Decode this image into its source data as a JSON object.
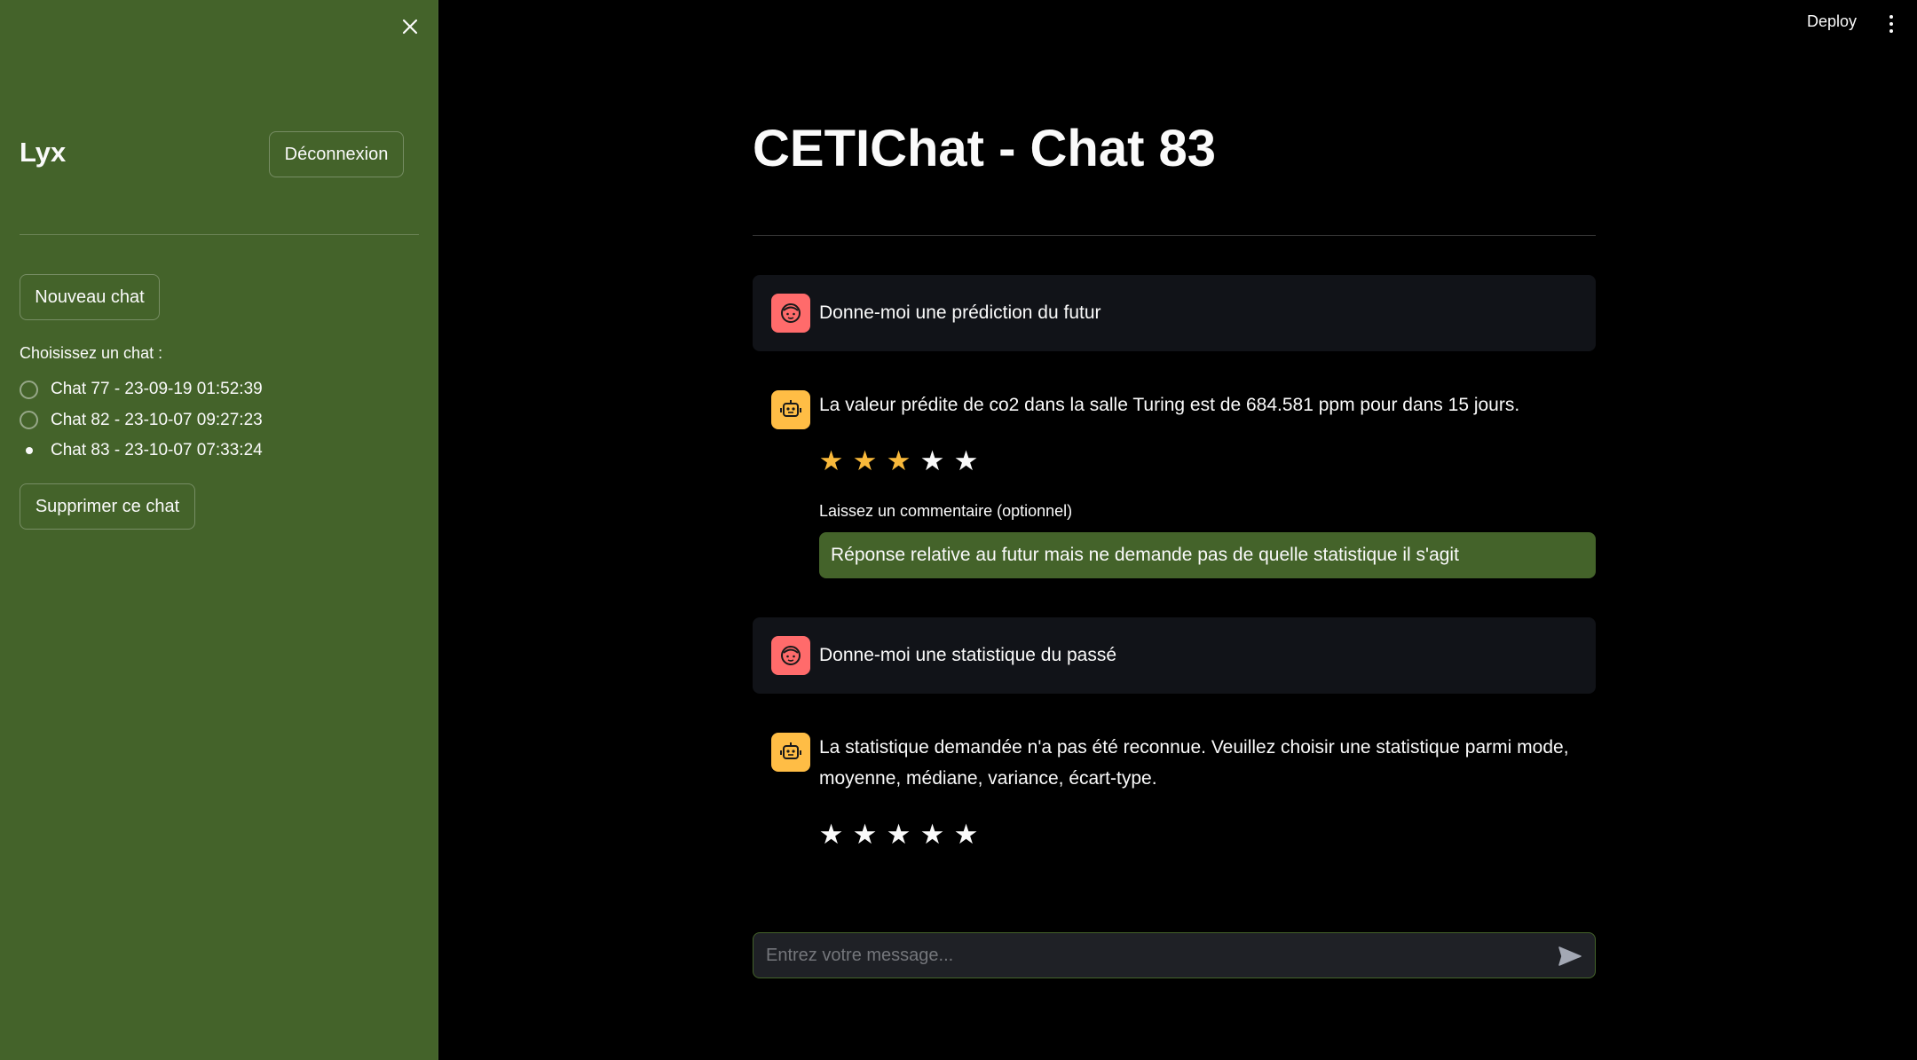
{
  "sidebar": {
    "username": "Lyx",
    "logout_label": "Déconnexion",
    "new_chat_label": "Nouveau chat",
    "chat_select_label": "Choisissez un chat :",
    "chats": [
      {
        "label": "Chat 77 - 23-09-19 01:52:39",
        "selected": false
      },
      {
        "label": "Chat 82 - 23-10-07 09:27:23",
        "selected": false
      },
      {
        "label": "Chat 83 - 23-10-07 07:33:24",
        "selected": true
      }
    ],
    "delete_label": "Supprimer ce chat",
    "background_color": "#44632a"
  },
  "header": {
    "deploy_label": "Deploy"
  },
  "main": {
    "title": "CETIChat - Chat 83",
    "messages": [
      {
        "role": "user",
        "text": "Donne-moi une prédiction du futur"
      },
      {
        "role": "assistant",
        "text": "La valeur prédite de co2 dans la salle Turing est de 684.581 ppm pour dans 15 jours.",
        "rating": 3,
        "comment_label": "Laissez un commentaire (optionnel)",
        "comment_value": "Réponse relative au futur mais ne demande pas de quelle statistique il s'agit"
      },
      {
        "role": "user",
        "text": "Donne-moi une statistique du passé"
      },
      {
        "role": "assistant",
        "text_line1": "La statistique demandée n'a pas été reconnue. Veuillez choisir une statistique parmi mode,",
        "text_line2": "moyenne, médiane, variance, écart-type.",
        "rating": 0
      }
    ],
    "input_placeholder": "Entrez votre message...",
    "colors": {
      "user_avatar": "#ff6b6b",
      "bot_avatar": "#ffbd45",
      "star_active": "#f9b93b"
    }
  },
  "icons": {
    "close": "close-icon",
    "user_avatar": "user-face-icon",
    "bot_avatar": "robot-icon",
    "send": "send-icon",
    "menu": "kebab-menu-icon"
  }
}
